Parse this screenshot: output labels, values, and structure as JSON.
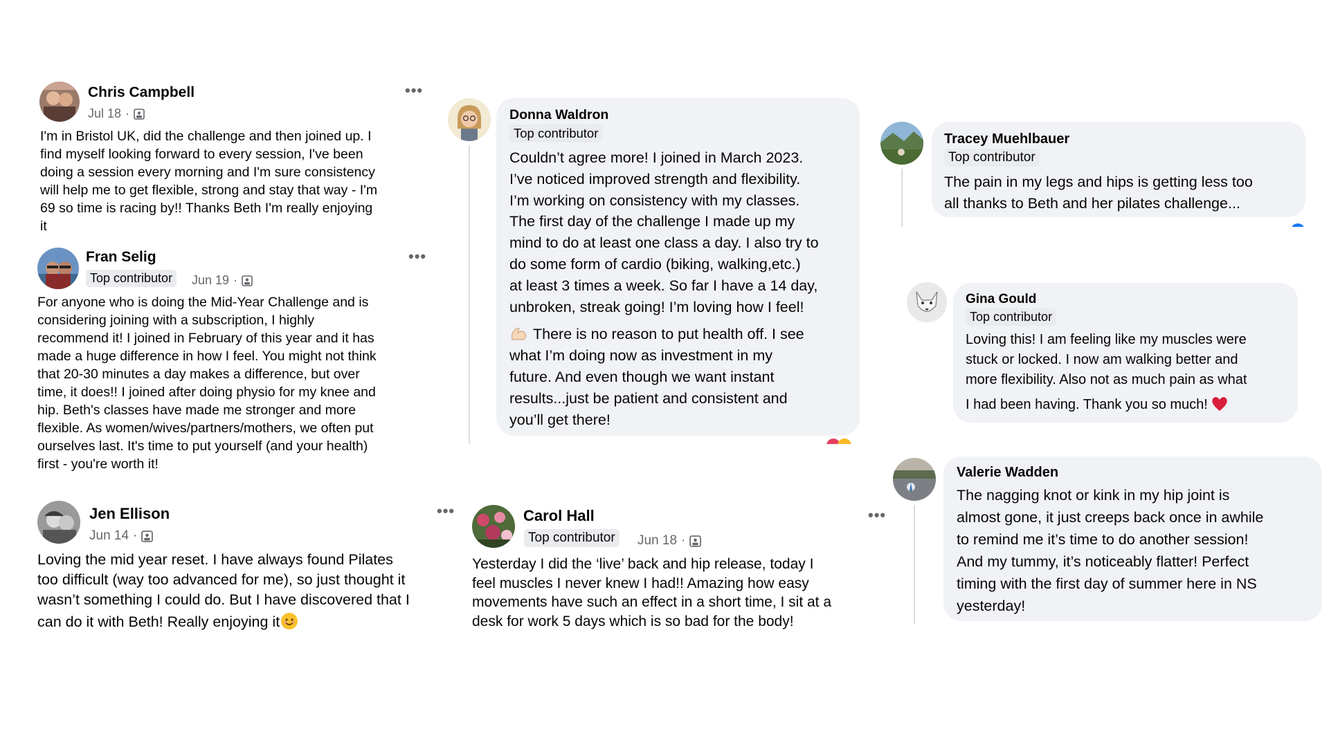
{
  "icons": {
    "more": "more-horizontal-icon",
    "audience": "group-audience-icon",
    "muscle": "flexed-biceps-emoji",
    "heart": "red-heart-emoji",
    "smile": "smiling-face-emoji"
  },
  "posts": {
    "chris": {
      "name": "Chris Campbell",
      "date": "Jul 18",
      "separator": "·",
      "lines": [
        "I'm in Bristol UK, did the challenge and then joined up.  I",
        "find myself looking forward to every session, I've been",
        "doing a session every morning and I'm sure consistency",
        "will help me to get flexible, strong and stay that way - I'm",
        "69 so time is racing by!!  Thanks Beth I'm really enjoying",
        "it"
      ]
    },
    "fran": {
      "name": "Fran Selig",
      "badge": "Top contributor",
      "date": "Jun 19",
      "separator": "·",
      "lines": [
        "For anyone who is doing the Mid-Year Challenge and is",
        "considering joining with a subscription, I highly",
        "recommend it!  I joined in February of this year and it has",
        "made a huge difference in how I feel. You might not think",
        "that 20-30 minutes a day makes a difference, but over",
        "time, it does!! I joined after doing physio for my knee and",
        "hip. Beth's classes have made me stronger and more",
        "flexible. As women/wives/partners/mothers, we often put",
        "ourselves last. It's time to put yourself (and your health)",
        "first - you're worth it!"
      ]
    },
    "jen": {
      "name": "Jen Ellison",
      "date": "Jun 14",
      "separator": "·",
      "lines": [
        "Loving the mid year reset.  I have always found Pilates",
        "too difficult (way too advanced for me), so just thought it",
        "wasn’t something I could do. But I have discovered that I",
        "can do it with Beth! Really enjoying it"
      ]
    },
    "donna": {
      "name": "Donna Waldron",
      "badge": "Top contributor",
      "lines": [
        "Couldn’t agree more! I joined in March 2023.",
        "I’ve noticed improved strength and flexibility.",
        "I’m working on consistency with my classes.",
        "The first day of the challenge I made up my",
        "mind to do at least one class a day. I also try to",
        "do some form of cardio (biking, walking,etc.)",
        "at least 3 times a week. So far I have a 14 day,",
        "unbroken, streak going! I’m loving how I feel!"
      ],
      "lines2": [
        "There is no reason to put health off. I see",
        "what I’m doing now as investment in my",
        "future. And even though we want instant",
        "results...just be patient and consistent and",
        "you’ll get there!"
      ]
    },
    "carol": {
      "name": "Carol Hall",
      "badge": "Top contributor",
      "date": "Jun 18",
      "separator": "·",
      "lines": [
        "Yesterday I did the ‘live’ back and hip release, today I",
        "feel muscles I never knew I had!! Amazing how easy",
        "movements have such an effect in a short time, I sit at a",
        "desk for work 5 days which is so bad for the body!"
      ]
    },
    "tracey": {
      "name": "Tracey Muehlbauer",
      "badge": "Top contributor",
      "lines": [
        "The pain in my legs and hips is getting less too",
        "all thanks to Beth and her pilates challenge..."
      ]
    },
    "gina": {
      "name": "Gina Gould",
      "badge": "Top contributor",
      "lines": [
        "Loving this!  I am feeling like my muscles were",
        "stuck or locked.  I now am walking better and",
        "more flexibility.  Also not as much pain as what",
        "I had been having.  Thank you so much!"
      ]
    },
    "valerie": {
      "name": "Valerie Wadden",
      "lines": [
        "The nagging knot or kink in my hip joint is",
        "almost gone, it just creeps back once in awhile",
        "to remind me it’s time to do another session!",
        "And my tummy, it’s noticeably flatter! Perfect",
        "timing with the first day of summer here in NS",
        "yesterday!"
      ]
    }
  }
}
